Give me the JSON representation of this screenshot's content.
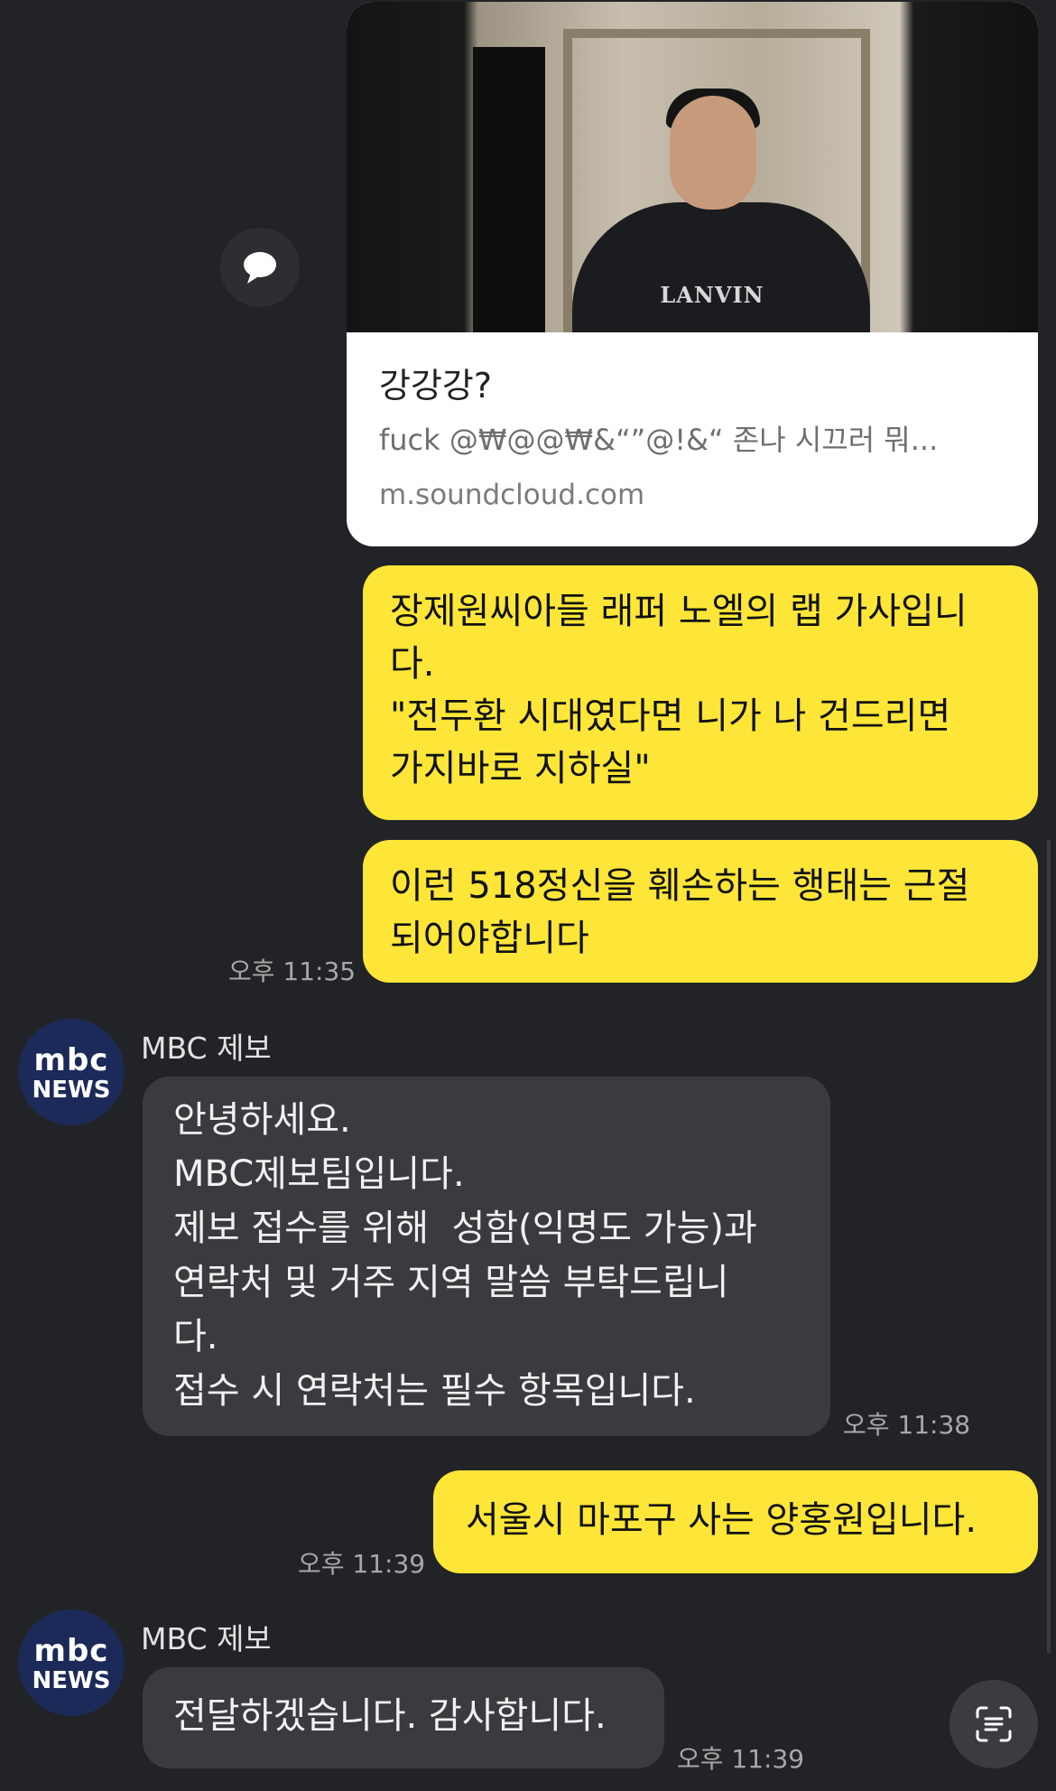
{
  "link_preview": {
    "title": "강강강?",
    "description": "fuck @₩@@₩&“”@!&“ 존나 시끄러 뭐...",
    "url": "m.soundcloud.com",
    "image_text": "LANVIN"
  },
  "share_button": {
    "icon": "speech-bubble-icon"
  },
  "messages_me": [
    {
      "text": "장제원씨아들 래퍼 노엘의 랩 가사입니\n다.\n\"전두환 시대였다면 니가 나 건드리면\n가지바로 지하실\""
    },
    {
      "text": "이런 518정신을 훼손하는 행태는 근절\n되어야합니다",
      "time": "오후 11:35"
    },
    {
      "text": "서울시 마포구 사는 양홍원입니다.",
      "time": "오후 11:39"
    }
  ],
  "bot": {
    "name": "MBC 제보",
    "avatar_line1": "mbc",
    "avatar_line2": "NEWS",
    "messages": [
      {
        "text": "안녕하세요.\nMBC제보팀입니다.\n제보 접수를 위해  성함(익명도 가능)과\n연락처 및 거주 지역 말씀 부탁드립니\n다.\n접수 시 연락처는 필수 항목입니다.",
        "time": "오후 11:38"
      },
      {
        "text": "전달하겠습니다. 감사합니다.",
        "time": "오후 11:39"
      }
    ]
  },
  "scan_button": {
    "icon": "text-scan-icon"
  },
  "colors": {
    "background": "#222326",
    "my_bubble": "#fde637",
    "bot_bubble": "#3a3b3f",
    "avatar": "#1c2a59"
  }
}
